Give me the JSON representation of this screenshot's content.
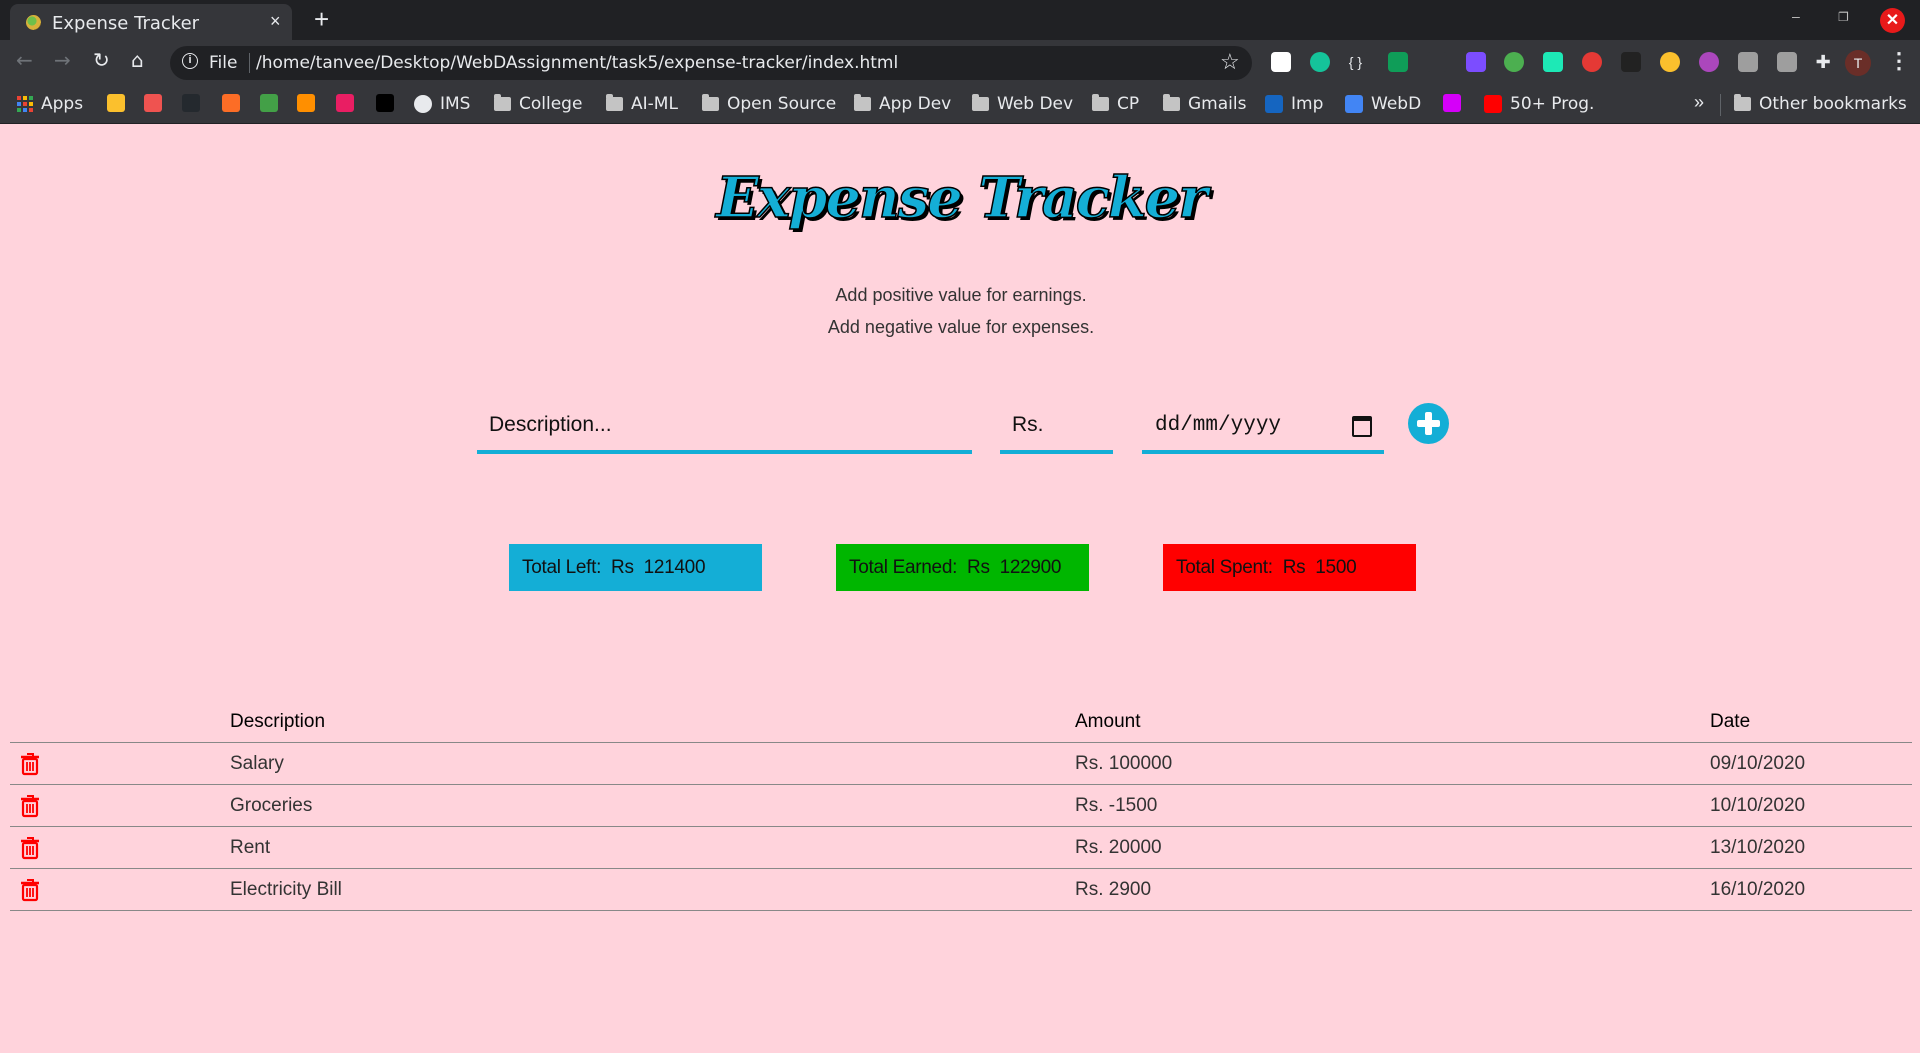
{
  "browser": {
    "tab_title": "Expense Tracker",
    "tab_close": "×",
    "new_tab": "+",
    "window_controls": {
      "minimize": "–",
      "maximize": "❐",
      "close": "✕"
    },
    "nav": {
      "back": "←",
      "forward": "→",
      "reload": "↻",
      "home": "⌂"
    },
    "omnibox": {
      "info": "i",
      "scheme": "File",
      "url": "/home/tanvee/Desktop/WebDAssignment/task5/expense-tracker/index.html",
      "star": "☆"
    },
    "extensions": [
      {
        "name": "bar-chart-extension",
        "color": "#ffffff"
      },
      {
        "name": "grammarly-extension",
        "color": "#15c39a"
      },
      {
        "name": "json-extension",
        "color": "#35363a"
      },
      {
        "name": "google-plus-extension",
        "color": "#0f9d58"
      },
      {
        "name": "arrow-extension",
        "color": "#35363a"
      },
      {
        "name": "squares-extension",
        "color": "#7c4dff"
      },
      {
        "name": "add-extension",
        "color": "#4caf50"
      },
      {
        "name": "robot-extension",
        "color": "#1de9b6"
      },
      {
        "name": "stop-hand-extension",
        "color": "#e53935"
      },
      {
        "name": "screen-capture-extension",
        "color": "#222222"
      },
      {
        "name": "emoji-extension",
        "color": "#fbc02d"
      },
      {
        "name": "color-wheel-extension",
        "color": "#ab47bc"
      },
      {
        "name": "pill-extension",
        "color": "#9e9e9e"
      },
      {
        "name": "smiley-extension",
        "color": "#9e9e9e"
      },
      {
        "name": "puzzle-extension",
        "color": "#35363a"
      }
    ],
    "profile_initial": "T",
    "menu": "⋮",
    "bookmarks": [
      {
        "label": "Apps",
        "type": "apps"
      },
      {
        "label": "",
        "type": "icon",
        "color": "#fbc02d"
      },
      {
        "label": "",
        "type": "icon",
        "color": "#ef5350"
      },
      {
        "label": "",
        "type": "icon",
        "color": "#24292e"
      },
      {
        "label": "",
        "type": "icon",
        "color": "#fc6d26"
      },
      {
        "label": "",
        "type": "icon",
        "color": "#43a047"
      },
      {
        "label": "",
        "type": "icon",
        "color": "#ff8f00"
      },
      {
        "label": "",
        "type": "icon",
        "color": "#e91e63"
      },
      {
        "label": "",
        "type": "icon",
        "color": "#000000"
      },
      {
        "label": "IMS",
        "type": "globe"
      },
      {
        "label": "College",
        "type": "folder"
      },
      {
        "label": "AI-ML",
        "type": "folder"
      },
      {
        "label": "Open Source",
        "type": "folder"
      },
      {
        "label": "App Dev",
        "type": "folder"
      },
      {
        "label": "Web Dev",
        "type": "folder"
      },
      {
        "label": "CP",
        "type": "folder"
      },
      {
        "label": "Gmails",
        "type": "folder"
      },
      {
        "label": "Imp",
        "type": "icon",
        "color": "#1565c0"
      },
      {
        "label": "WebD",
        "type": "icon",
        "color": "#4285f4"
      },
      {
        "label": "",
        "type": "icon",
        "color": "#d500f9"
      },
      {
        "label": "50+ Prog.",
        "type": "icon",
        "color": "#ff0000"
      }
    ],
    "bookmarks_more": "»",
    "other_bookmarks": "Other bookmarks"
  },
  "app": {
    "title": "Expense Tracker",
    "hints": [
      "Add positive value for earnings.",
      "Add negative value for expenses."
    ],
    "form": {
      "description_placeholder": "Description...",
      "amount_placeholder": "Rs.",
      "date_placeholder": "dd/mm/yyyy",
      "add_icon": "plus-circle"
    },
    "stats": {
      "total_left": "Total Left:  Rs  121400",
      "total_earned": "Total Earned:  Rs  122900",
      "total_spent": "Total Spent:  Rs  1500"
    },
    "colors": {
      "accent": "#14aed6",
      "earned": "#00b600",
      "spent": "#ff0000",
      "background": "#ffd3dc",
      "trash": "#ff0000"
    },
    "table": {
      "headers": {
        "description": "Description",
        "amount": "Amount",
        "date": "Date"
      },
      "rows": [
        {
          "description": "Salary",
          "amount": "Rs. 100000",
          "date": "09/10/2020"
        },
        {
          "description": "Groceries",
          "amount": "Rs. -1500",
          "date": "10/10/2020"
        },
        {
          "description": "Rent",
          "amount": "Rs. 20000",
          "date": "13/10/2020"
        },
        {
          "description": "Electricity Bill",
          "amount": "Rs. 2900",
          "date": "16/10/2020"
        }
      ]
    }
  }
}
